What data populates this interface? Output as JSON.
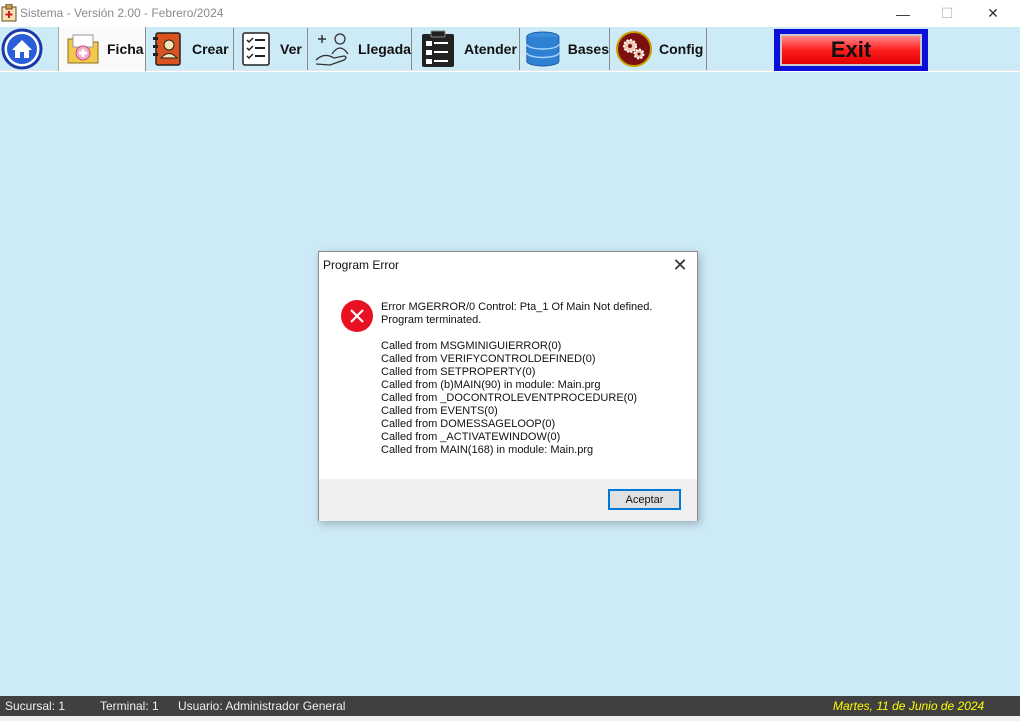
{
  "window": {
    "title": "Sistema - Versión 2.00 - Febrero/2024",
    "minimize_glyph": "—",
    "maximize_glyph": "☐",
    "close_glyph": "✕"
  },
  "toolbar": {
    "items": [
      {
        "label": "",
        "icon": "home-icon"
      },
      {
        "label": "Ficha",
        "icon": "medical-folder-icon"
      },
      {
        "label": "Crear",
        "icon": "address-book-icon"
      },
      {
        "label": "Ver",
        "icon": "checklist-icon"
      },
      {
        "label": "Llegada",
        "icon": "patient-arrival-icon"
      },
      {
        "label": "Atender",
        "icon": "clipboard-icon"
      },
      {
        "label": "Bases",
        "icon": "database-icon"
      },
      {
        "label": "Config",
        "icon": "gears-icon"
      }
    ],
    "exit_label": "Exit"
  },
  "dialog": {
    "title": "Program Error",
    "close_glyph": "✕",
    "error_line1": "Error MGERROR/0  Control: Pta_1 Of Main Not defined.",
    "error_line2": "Program terminated.",
    "call_stack": [
      "Called from MSGMINIGUIERROR(0)",
      "Called from VERIFYCONTROLDEFINED(0)",
      "Called from SETPROPERTY(0)",
      "Called from (b)MAIN(90) in module: Main.prg",
      "Called from _DOCONTROLEVENTPROCEDURE(0)",
      "Called from EVENTS(0)",
      "Called from DOMESSAGELOOP(0)",
      "Called from _ACTIVATEWINDOW(0)",
      "Called from MAIN(168) in module: Main.prg"
    ],
    "accept_label": "Aceptar"
  },
  "status": {
    "sucursal": "Sucursal: 1",
    "terminal": "Terminal: 1",
    "usuario": "Usuario: Administrador General",
    "date": "Martes, 11 de Junio de 2024"
  },
  "colors": {
    "background": "#cdeaf7",
    "status_bg": "#404040",
    "date_color": "#ffff00",
    "error_red": "#e81123",
    "exit_border": "#0a10d8"
  }
}
